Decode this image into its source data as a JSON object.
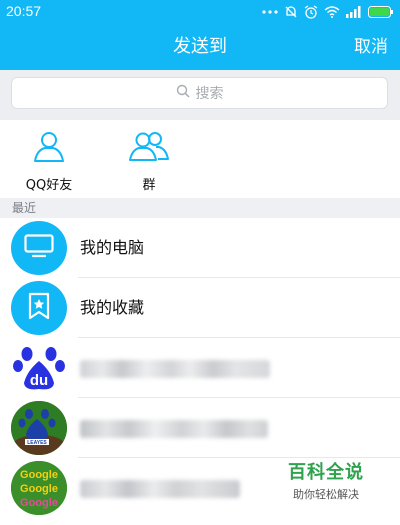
{
  "status_bar": {
    "time": "20:57",
    "icons": [
      "more-dots-icon",
      "mute-bell-icon",
      "alarm-icon",
      "wifi-icon",
      "signal-icon",
      "battery-icon"
    ]
  },
  "header": {
    "title": "发送到",
    "cancel_label": "取消"
  },
  "search": {
    "placeholder": "搜索"
  },
  "shortcuts": [
    {
      "label": "QQ好友",
      "icon": "single-user-icon"
    },
    {
      "label": "群",
      "icon": "group-users-icon"
    }
  ],
  "recent": {
    "header": "最近",
    "items": [
      {
        "name": "我的电脑",
        "icon": "monitor-icon"
      },
      {
        "name": "我的收藏",
        "icon": "bookmark-star-icon"
      },
      {
        "name": "",
        "icon": "baidu-paw-logo",
        "blurred": true
      },
      {
        "name": "",
        "icon": "green-paw-avatar",
        "blurred": true
      },
      {
        "name": "",
        "icon": "google-text-avatar",
        "blurred": true
      }
    ]
  },
  "watermark": {
    "main": "百科全说",
    "sub": "助你轻松解决"
  },
  "colors": {
    "accent": "#12b7f5",
    "section_bg": "#eef0f3",
    "watermark_green": "#2fa24e"
  }
}
